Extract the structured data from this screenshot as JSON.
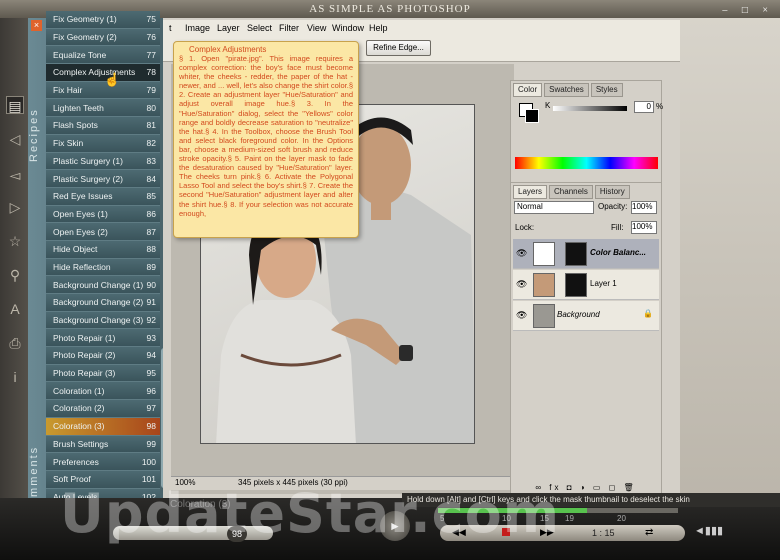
{
  "app": {
    "title": "AS SIMPLE AS PHOTOSHOP",
    "window_controls": "– □ ×"
  },
  "sidebar": {
    "tab_label": "Recipes",
    "tab_label_bottom": "Comments",
    "close_icon": "×",
    "recipes": [
      {
        "label": "Fix Geometry (1)",
        "num": "75"
      },
      {
        "label": "Fix Geometry (2)",
        "num": "76"
      },
      {
        "label": "Equalize Tone",
        "num": "77"
      },
      {
        "label": "Complex Adjustments",
        "num": "78",
        "state": "selected"
      },
      {
        "label": "Fix Hair",
        "num": "79"
      },
      {
        "label": "Lighten Teeth",
        "num": "80"
      },
      {
        "label": "Flash Spots",
        "num": "81"
      },
      {
        "label": "Fix Skin",
        "num": "82"
      },
      {
        "label": "Plastic Surgery (1)",
        "num": "83"
      },
      {
        "label": "Plastic Surgery (2)",
        "num": "84"
      },
      {
        "label": "Red Eye Issues",
        "num": "85"
      },
      {
        "label": "Open Eyes (1)",
        "num": "86"
      },
      {
        "label": "Open Eyes (2)",
        "num": "87"
      },
      {
        "label": "Hide Object",
        "num": "88"
      },
      {
        "label": "Hide Reflection",
        "num": "89"
      },
      {
        "label": "Background Change (1)",
        "num": "90"
      },
      {
        "label": "Background Change (2)",
        "num": "91"
      },
      {
        "label": "Background Change (3)",
        "num": "92"
      },
      {
        "label": "Photo Repair (1)",
        "num": "93"
      },
      {
        "label": "Photo Repair (2)",
        "num": "94"
      },
      {
        "label": "Photo Repair (3)",
        "num": "95"
      },
      {
        "label": "Coloration (1)",
        "num": "96"
      },
      {
        "label": "Coloration (2)",
        "num": "97"
      },
      {
        "label": "Coloration (3)",
        "num": "98",
        "state": "highlight"
      },
      {
        "label": "Brush Settings",
        "num": "99"
      },
      {
        "label": "Preferences",
        "num": "100"
      },
      {
        "label": "Soft Proof",
        "num": "101"
      },
      {
        "label": "Auto Levels",
        "num": "102"
      },
      {
        "label": "Camera Raw Plugin (1)",
        "num": "103"
      }
    ]
  },
  "rail_icons": [
    "book-icon",
    "arrow-left-icon",
    "arrow-right-icon",
    "star-icon",
    "search-icon",
    "text-icon",
    "print-icon",
    "info-icon"
  ],
  "photoshop": {
    "menu": [
      "t",
      "Image",
      "Layer",
      "Select",
      "Filter",
      "View",
      "Window",
      "Help"
    ],
    "refine_edge": "Refine Edge...",
    "zoom": "100%",
    "doc_info": "345 pixels x 445 pixels (30 ppi)",
    "color_tabs": [
      "Color",
      "Swatches",
      "Styles"
    ],
    "color_k_label": "K",
    "color_k_value": "0",
    "color_k_unit": "%",
    "layer_tabs": [
      "Layers",
      "Channels",
      "History"
    ],
    "blend_mode": "Normal",
    "opacity_label": "Opacity:",
    "opacity": "100%",
    "lock_label": "Lock:",
    "fill_label": "Fill:",
    "fill": "100%",
    "layers": [
      {
        "name": "Color Balanc...",
        "active": true
      },
      {
        "name": "Layer 1",
        "active": false
      },
      {
        "name": "Background",
        "active": false
      }
    ],
    "layer_footer_icons": "∞ fx ◘ ◑ ▭ ◻ 🗑"
  },
  "note": {
    "heading": "Complex Adjustments",
    "text": "§ 1. Open \"pirate.jpg\". This image requires a complex correction: the boy's face must become whiter, the cheeks - redder, the paper of the hat - newer, and ... well, let's also change the shirt color.§ 2. Create an adjustment layer \"Hue/Saturation\" and adjust overall image hue.§ 3. In the \"Hue/Saturation\" dialog, select the \"Yellows\" color range and boldly decrease saturation to \"neutralize\" the hat.§ 4. In the Toolbox, choose the Brush Tool and select black foreground color. In the Options bar, choose a medium-sized soft brush and reduce stroke opacity.§ 5. Paint on the layer mask to fade the desaturation caused by \"Hue/Saturation\" layer. The cheeks turn pink.§ 6. Activate the Polygonal Lasso Tool and select the boy's shirt.§ 7. Create the second \"Hue/Saturation\" adjustment layer and alter the shirt hue.§ 8. If your selection was not accurate enough,"
  },
  "player": {
    "caption": "Hold down [Alt] and [Ctrl] keys and click the mask thumbnail to deselect the skin",
    "progress": 0.62,
    "ticks": [
      "5",
      "10",
      "15",
      "19",
      "20"
    ],
    "time": "1 : 15",
    "page": "98",
    "play_icon": "►",
    "bottom_caption": "Coloration (3)"
  },
  "watermark": "UpdateStar.com",
  "colors": {
    "highlight": "#a8451b",
    "selected": "#1f2b2e",
    "progress": "#58c24e",
    "note_text": "#d24a1e"
  }
}
